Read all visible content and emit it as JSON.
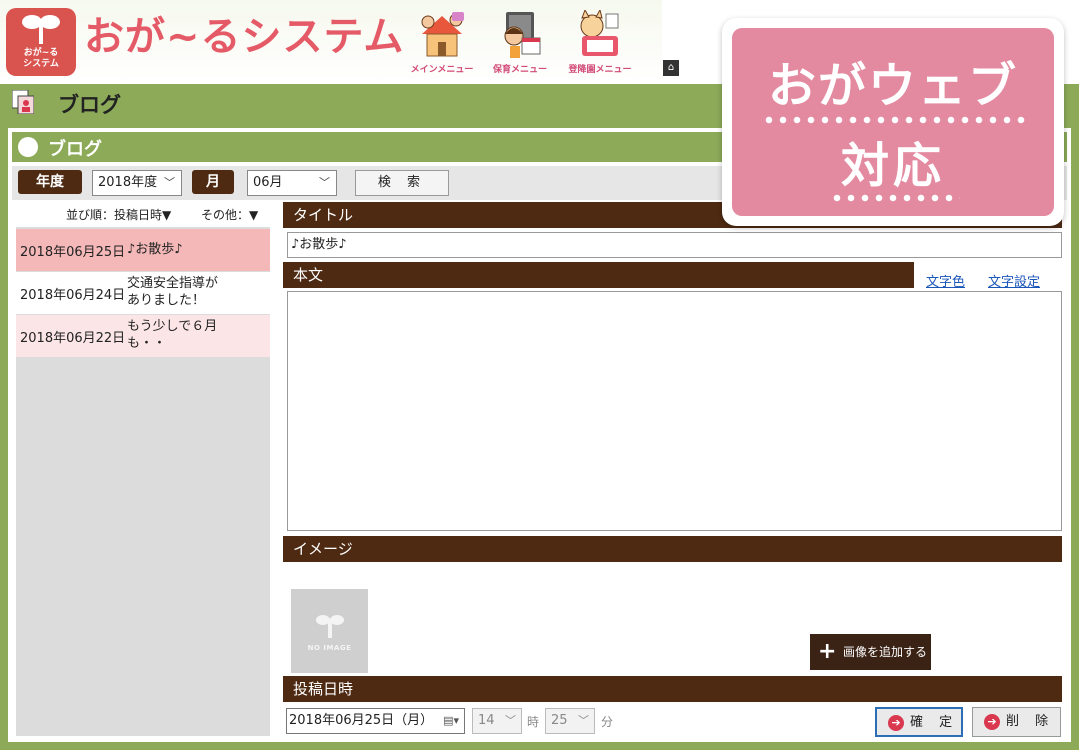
{
  "header": {
    "logo_text_line1": "おが~る",
    "logo_text_line2": "システム",
    "app_title": "おが~るシステム",
    "menus": [
      {
        "label": "メインメニュー",
        "icon": "house-family-icon"
      },
      {
        "label": "保育メニュー",
        "icon": "childcare-icon"
      },
      {
        "label": "登降園メニュー",
        "icon": "attendance-icon"
      }
    ],
    "home_icon": "home-icon"
  },
  "page": {
    "title": "ブログ",
    "panel_title": "ブログ"
  },
  "filter": {
    "year_tag": "年度",
    "year_value": "2018年度",
    "month_tag": "月",
    "month_value": "06月",
    "search_label": "検 索"
  },
  "list": {
    "sort_label": "並び順：投稿日時▼",
    "other_label": "その他：▼",
    "items": [
      {
        "date": "2018年06月25日",
        "title": "♪お散歩♪",
        "title_line2": ""
      },
      {
        "date": "2018年06月24日",
        "title": "交通安全指導が",
        "title_line2": "ありました！"
      },
      {
        "date": "2018年06月22日",
        "title": "もう少しで６月",
        "title_line2": "も・・"
      }
    ]
  },
  "editor": {
    "title_header": "タイトル",
    "title_value": "♪お散歩♪",
    "body_header": "本文",
    "text_color_link": "文字色",
    "text_setting_link": "文字設定",
    "body_value": "",
    "image_header": "イメージ",
    "no_image_text": "NO IMAGE",
    "add_image_label": "画像を追加する",
    "posted_header": "投稿日時",
    "posted_date": "2018年06月25日（月）",
    "hour_value": "14",
    "hour_unit": "時",
    "minute_value": "25",
    "minute_unit": "分",
    "confirm_label": "確 定",
    "delete_label": "削 除"
  },
  "badge": {
    "line1": "おがウェブ",
    "line2": "対応"
  },
  "colors": {
    "accent_green": "#8caa58",
    "header_brown": "#4e2a12",
    "brand_red": "#d9534f",
    "badge_pink": "#e48aa0",
    "selected_row": "#f4b8b8",
    "alt_row": "#fbe5e6"
  }
}
